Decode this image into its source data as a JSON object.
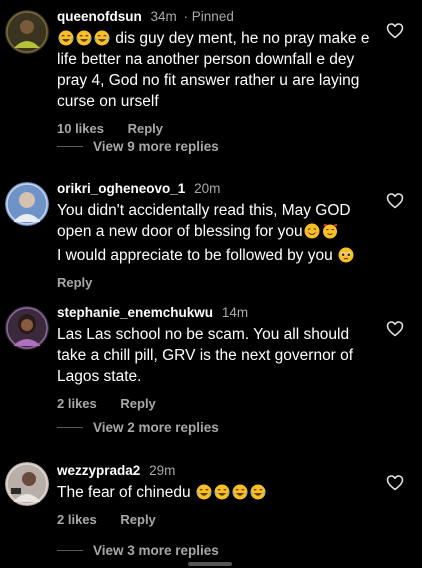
{
  "comments": [
    {
      "username": "queenofdsun",
      "time": "34m",
      "pinned": "· Pinned",
      "text_after_emoji": " dis guy dey ment, he no pray make e life better na another person downfall e dey pray 4, God no fit answer rather u are laying curse on urself",
      "likes": "10 likes",
      "reply": "Reply",
      "view_replies": "View 9 more replies",
      "leading_emojis": [
        "joy-emoji",
        "joy-emoji",
        "joy-emoji"
      ],
      "avatar_color": "#3a3a2a"
    },
    {
      "username": "orikri_ogheneovo_1",
      "time": "20m",
      "line1": "You didn't accidentally read this, May GOD open a new door of blessing for you",
      "line2": "I would appreciate to be followed by you",
      "reply": "Reply",
      "line1_emojis": [
        "smiling-blush-emoji",
        "hearts-face-emoji"
      ],
      "line2_emojis": [
        "pleading-emoji"
      ],
      "avatar_color": "#4a6fa5"
    },
    {
      "username": "stephanie_enemchukwu",
      "time": "14m",
      "text": "Las Las school no be scam. You all should take a chill pill, GRV is the next governor of Lagos state.",
      "likes": "2 likes",
      "reply": "Reply",
      "view_replies": "View 2 more replies",
      "avatar_color": "#6a4a6a"
    },
    {
      "username": "wezzyprada2",
      "time": "29m",
      "text_before_emoji": "The fear of chinedu ",
      "trailing_emojis": [
        "joy-emoji",
        "joy-emoji",
        "joy-emoji",
        "joy-emoji"
      ],
      "likes": "2 likes",
      "reply": "Reply",
      "view_replies": "View 3 more replies",
      "avatar_color": "#c8c0b8"
    }
  ],
  "colors": {
    "background": "#000000",
    "text": "#ffffff",
    "secondary": "#a8a8a8"
  }
}
